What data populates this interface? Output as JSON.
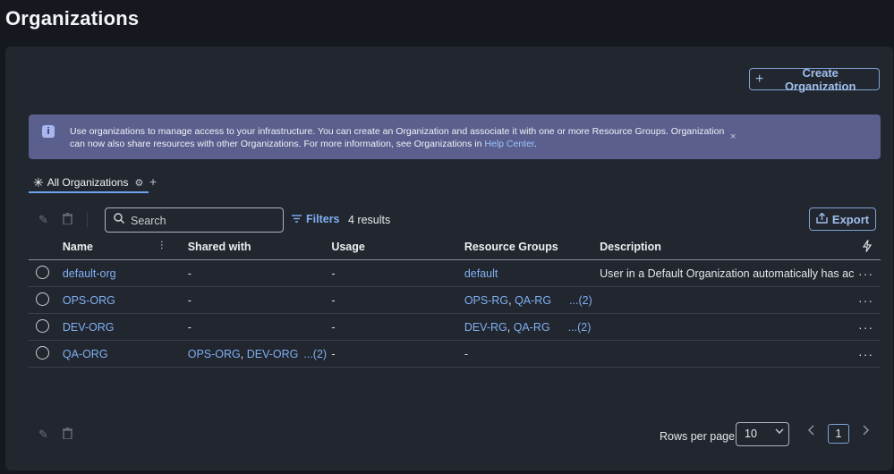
{
  "page": {
    "title": "Organizations"
  },
  "actions": {
    "create_label": "Create Organization",
    "export_label": "Export"
  },
  "banner": {
    "text": "Use organizations to manage access to your infrastructure. You can create an Organization and associate it with one or more Resource Groups. Organization can now also share resources with other Organizations. For more information, see Organizations in ",
    "link": "Help Center",
    "suffix": ".",
    "close": "×"
  },
  "tabs": {
    "active_label": "All Organizations",
    "add": "+"
  },
  "toolbar": {
    "search_placeholder": "Search",
    "filters_label": "Filters",
    "results": "4 results"
  },
  "table": {
    "columns": {
      "name": "Name",
      "shared": "Shared with",
      "usage": "Usage",
      "resource_groups": "Resource Groups",
      "description": "Description"
    },
    "rows": [
      {
        "name": "default-org",
        "shared": "-",
        "shared_links": [],
        "shared_more": "",
        "usage": "-",
        "rg": [
          {
            "t": "default"
          }
        ],
        "rg_more": "",
        "rg_plain": "",
        "description": "User in a Default Organization automatically has ac"
      },
      {
        "name": "OPS-ORG",
        "shared": "-",
        "usage": "-",
        "rg": [
          {
            "t": "OPS-RG"
          },
          {
            "t": "QA-RG"
          }
        ],
        "rg_more": "...(2)",
        "description": ""
      },
      {
        "name": "DEV-ORG",
        "shared": "-",
        "usage": "-",
        "rg": [
          {
            "t": "DEV-RG"
          },
          {
            "t": "QA-RG"
          }
        ],
        "rg_more": "...(2)",
        "description": ""
      },
      {
        "name": "QA-ORG",
        "shared_links": [
          "OPS-ORG",
          "DEV-ORG"
        ],
        "shared_more": "...(2)",
        "usage": "-",
        "rg_plain": "-",
        "description": ""
      }
    ],
    "more_icon": "···"
  },
  "pagination": {
    "rows_per_page_label": "Rows per page",
    "rows_per_page": "10",
    "current_page": "1"
  },
  "colors": {
    "accent": "#7fb0f3",
    "banner_bg": "#5a5f8d",
    "panel_bg": "#22262e",
    "page_bg": "#15181e"
  }
}
